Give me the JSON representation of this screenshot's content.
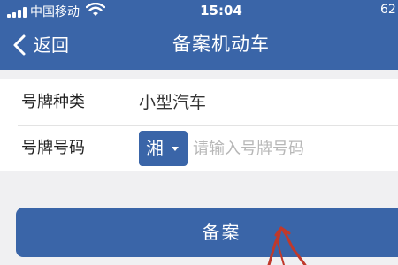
{
  "status_bar": {
    "carrier": "中国移动",
    "time": "15:04",
    "battery": "62",
    "icons": [
      "signal-icon",
      "wifi-icon"
    ]
  },
  "nav": {
    "back_label": "返回",
    "title": "备案机动车",
    "back_icon": "chevron-left-icon"
  },
  "form": {
    "plate_type_label": "号牌种类",
    "plate_type_value": "小型汽车",
    "plate_number_label": "号牌号码",
    "province_value": "湘",
    "province_icon": "caret-down-icon",
    "plate_number_placeholder": "请输入号牌号码",
    "plate_number_value": ""
  },
  "submit": {
    "label": "备案"
  },
  "colors": {
    "primary": "#3a65a8",
    "background": "#f0f0f2",
    "annotation": "#c0392b"
  }
}
